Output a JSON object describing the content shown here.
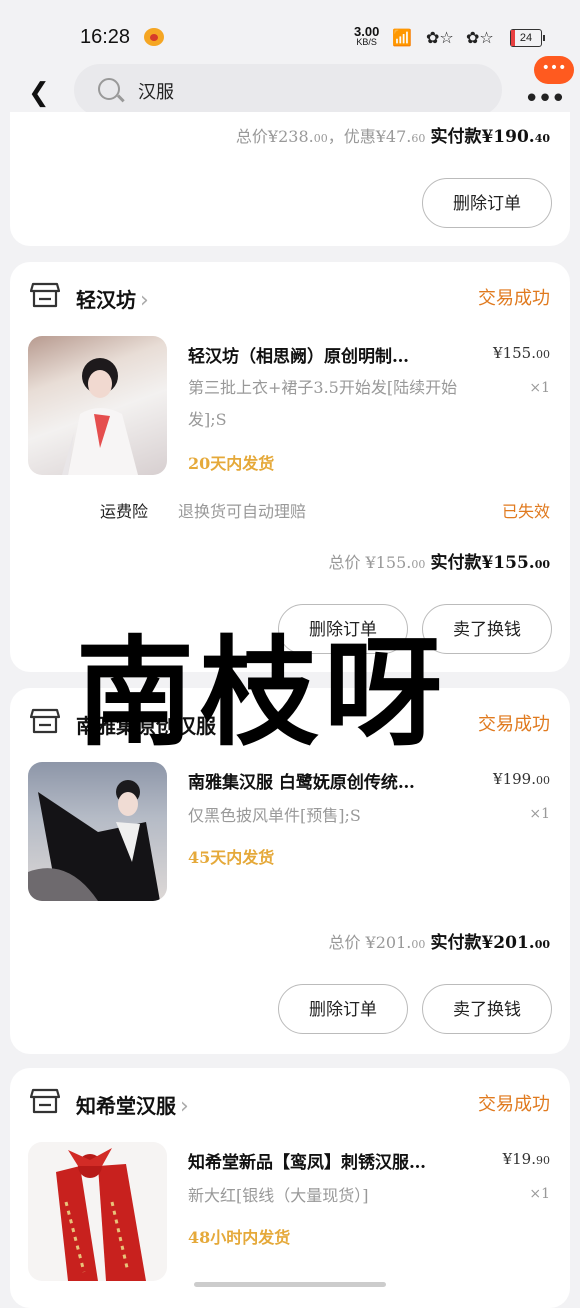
{
  "status_bar": {
    "time": "16:28",
    "net_speed": "3.00",
    "net_unit": "KB/S",
    "battery": "24"
  },
  "header": {
    "search_text": "汉服",
    "badge": "•••"
  },
  "orders": [
    {
      "total_label": "总价",
      "total": "¥238.",
      "total_dec": "00",
      "discount_label": "，优惠",
      "discount": "¥47.",
      "discount_dec": "60",
      "paid_label": "实付款",
      "paid": "¥190.",
      "paid_dec": "40",
      "buttons": [
        "删除订单"
      ]
    },
    {
      "shop": "轻汉坊",
      "status": "交易成功",
      "product_title": "轻汉坊（相思阙）原创明制…",
      "price": "¥155.",
      "price_dec": "00",
      "spec": "第三批上衣+裙子3.5开始发[陆续开始发];S",
      "qty": "×1",
      "shipping": "20天内发货",
      "insurance_label": "运费险",
      "insurance_desc": "退换货可自动理赔",
      "insurance_status": "已失效",
      "total_label": "总价",
      "total": "¥155.",
      "total_dec": "00",
      "paid_label": "实付款",
      "paid": "¥155.",
      "paid_dec": "00",
      "buttons": [
        "删除订单",
        "卖了换钱"
      ]
    },
    {
      "shop": "南雅集原创汉服",
      "status": "交易成功",
      "product_title": "南雅集汉服 白鹭妩原创传统…",
      "price": "¥199.",
      "price_dec": "00",
      "spec": "仅黑色披风单件[预售];S",
      "qty": "×1",
      "shipping": "45天内发货",
      "total_label": "总价",
      "total": "¥201.",
      "total_dec": "00",
      "paid_label": "实付款",
      "paid": "¥201.",
      "paid_dec": "00",
      "buttons": [
        "删除订单",
        "卖了换钱"
      ]
    },
    {
      "shop": "知希堂汉服",
      "status": "交易成功",
      "product_title": "知希堂新品【鸾凤】刺锈汉服…",
      "price": "¥19.",
      "price_dec": "90",
      "spec": "新大红[银线（大量现货）]",
      "qty": "×1",
      "shipping": "48小时内发货"
    }
  ],
  "watermark": "南枝呀",
  "colors": {
    "accent_orange": "#e07a1f",
    "shipping_gold": "#e5a93a",
    "badge": "#ff5a1f"
  }
}
